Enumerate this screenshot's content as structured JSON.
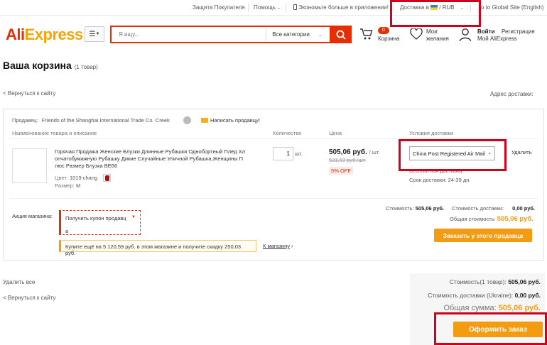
{
  "topbar": {
    "buyer_protection": "Защита Покупателя",
    "help": "Помощь",
    "app_promo": "Экономьте больше в приложении!",
    "ship_to": "Доставка в",
    "currency": "RUB",
    "global_site": "o to Global Site (English)"
  },
  "header": {
    "logo_ali": "Ali",
    "logo_express": "Express",
    "search_placeholder": "Я ищу...",
    "category": "Все категории",
    "cart_count": "0",
    "cart_label": "Корзина",
    "wishlist_line1": "Мои",
    "wishlist_line2": "желания",
    "signin": "Войти",
    "register": "Регистрация",
    "my_ali": "Мой AliExpress"
  },
  "page": {
    "title": "Ваша корзина",
    "title_count": "(1 товар)",
    "back_link": "< Вернуться к сайту",
    "address_label": "Адрес доставки:"
  },
  "store": {
    "seller_label": "Продавец:",
    "seller_name": "Friends of the Shanghai International Trade Co. Creek",
    "message_seller": "Написать продавцу!"
  },
  "columns": {
    "name": "Наименование товара и описание",
    "qty": "Количество",
    "price": "Цена",
    "shipping": "Условия доставки"
  },
  "item": {
    "title": "Горячая Продажа Женские Блузки Длинные Рубашки Однобортный Плед Хл опчатобумажную Рубашку Дикие Случайные Уличной Рубашка,Женщины П люс Размер Блузка BE66",
    "color_label": "Цвет:",
    "color_value": "1019 chang",
    "size_label": "Размер:",
    "size_value": "M",
    "qty": "1",
    "qty_unit": "шт.",
    "price": "505,06 руб.",
    "price_unit": "/ шт.",
    "old_price": "531,63 руб./шт.",
    "discount": "5% OFF",
    "shipping_method": "China Post Registered Air Mail",
    "free_shipping": "Бесплатная доставка",
    "delivery_time": "Срок доставки: 24-39 дн.",
    "delete": "Удалить"
  },
  "store_footer": {
    "promo_label": "Акция магазина:",
    "coupon_label": "Получить купон продавц",
    "coupon_label2": "а",
    "promo_text": "Купите ещё на 5 120,59 руб. в этом магазине и получите скидку 250,03 руб.",
    "to_store": "К магазину",
    "cost_label": "Стоимость:",
    "cost_value": "505,06 руб.",
    "shipping_label": "Стоимость доставки:",
    "shipping_value": "0,00 руб.",
    "total_label": "Общая стоимость:",
    "total_value": "505,06 руб.",
    "order_from_seller": "Заказать у этого продавца"
  },
  "bottom": {
    "delete_all": "Удалить все",
    "back_link": "< Вернуться к сайту",
    "cost_label": "Стоимость(1 товар):",
    "cost_value": "505,06 руб.",
    "shipping_label": "Стоимость доставки (Ukraine):",
    "shipping_value": "0,00 руб.",
    "total_label": "Общая сумма:",
    "total_value": "505,06 руб.",
    "checkout": "Оформить заказ"
  },
  "colors": {
    "brand_red": "#e62e04",
    "brand_orange": "#f7a400",
    "button_orange": "#f39c12",
    "highlight_red": "#d0021b"
  }
}
